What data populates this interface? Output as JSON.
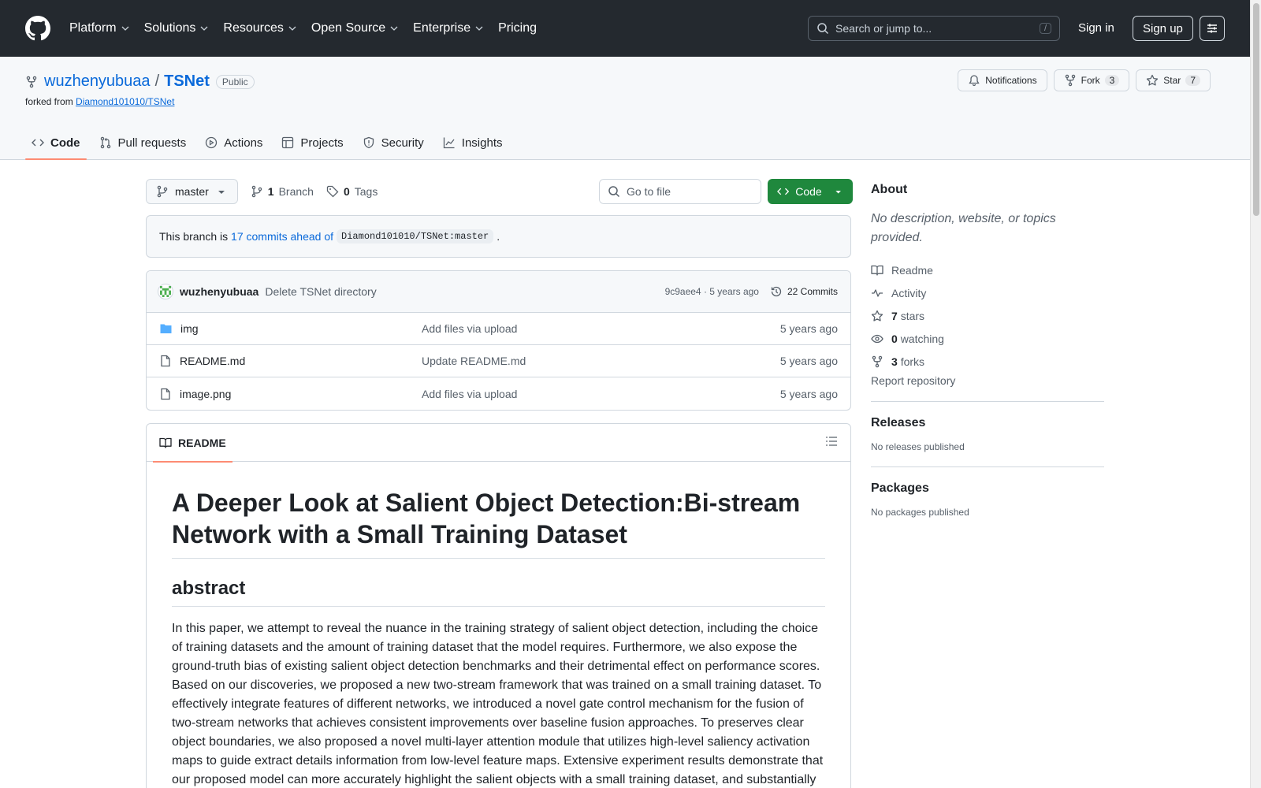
{
  "header": {
    "nav": [
      "Platform",
      "Solutions",
      "Resources",
      "Open Source",
      "Enterprise",
      "Pricing"
    ],
    "search_placeholder": "Search or jump to...",
    "search_hotkey": "/",
    "signin": "Sign in",
    "signup": "Sign up"
  },
  "repo": {
    "owner": "wuzhenyubuaa",
    "separator": "/",
    "name": "TSNet",
    "visibility": "Public",
    "forked_prefix": "forked from",
    "forked_from": "Diamond101010/TSNet",
    "notifications": "Notifications",
    "fork_label": "Fork",
    "fork_count": "3",
    "star_label": "Star",
    "star_count": "7",
    "tabs": [
      "Code",
      "Pull requests",
      "Actions",
      "Projects",
      "Security",
      "Insights"
    ]
  },
  "toolbar": {
    "branch": "master",
    "branch_count": "1",
    "branch_label": "Branch",
    "tag_count": "0",
    "tag_label": "Tags",
    "goto_placeholder": "Go to file",
    "code_button": "Code"
  },
  "ahead": {
    "prefix": "This branch is",
    "link": "17 commits ahead of",
    "ref": "Diamond101010/TSNet:master",
    "suffix": "."
  },
  "latest_commit": {
    "author": "wuzhenyubuaa",
    "message": "Delete TSNet directory",
    "sha_time": "9c9aee4 · 5 years ago",
    "commits": "22 Commits"
  },
  "files": [
    {
      "name": "img",
      "type": "folder",
      "commit": "Add files via upload",
      "age": "5 years ago"
    },
    {
      "name": "README.md",
      "type": "file",
      "commit": "Update README.md",
      "age": "5 years ago"
    },
    {
      "name": "image.png",
      "type": "file",
      "commit": "Add files via upload",
      "age": "5 years ago"
    }
  ],
  "readme": {
    "tab": "README",
    "h1": "A Deeper Look at Salient Object Detection:Bi-stream Network with a Small Training Dataset",
    "h2": "abstract",
    "paragraph": "In this paper, we attempt to reveal the nuance in the training strategy of salient object detection, including the choice of training datasets and the amount of training dataset that the model requires. Furthermore, we also expose the ground-truth bias of existing salient object detection benchmarks and their detrimental effect on performance scores. Based on our discoveries, we proposed a new two-stream framework that was trained on a small training dataset. To effectively integrate features of different networks, we introduced a novel gate control mechanism for the fusion of two-stream networks that achieves consistent improvements over baseline fusion approaches. To preserves clear object boundaries, we also proposed a novel multi-layer attention module that utilizes high-level saliency activation maps to guide extract details information from low-level feature maps. Extensive experiment results demonstrate that our proposed model can more accurately highlight the salient objects with a small training dataset, and substantially"
  },
  "sidebar": {
    "about_title": "About",
    "about_desc": "No description, website, or topics provided.",
    "readme": "Readme",
    "activity": "Activity",
    "stars_count": "7",
    "stars_label": "stars",
    "watching_count": "0",
    "watching_label": "watching",
    "forks_count": "3",
    "forks_label": "forks",
    "report": "Report repository",
    "releases_title": "Releases",
    "releases_empty": "No releases published",
    "packages_title": "Packages",
    "packages_empty": "No packages published"
  },
  "colors": {
    "header_bg": "#24292f",
    "link": "#0969da",
    "code_button": "#1f883d",
    "tab_underline": "#fd8c73"
  }
}
